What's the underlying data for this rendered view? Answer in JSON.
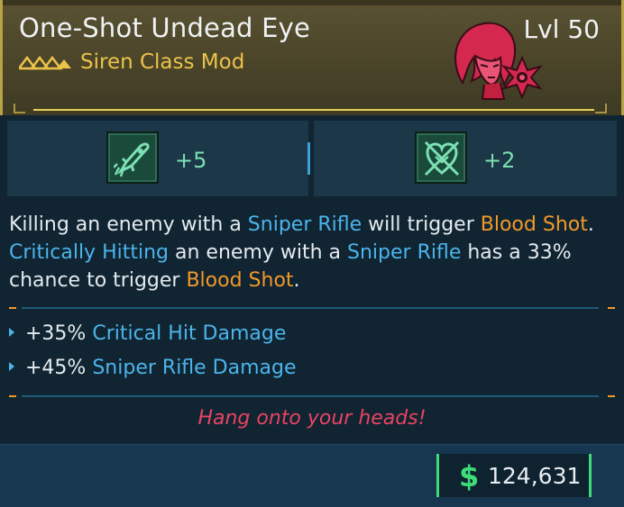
{
  "item": {
    "name": "One-Shot Undead Eye",
    "type": "Siren Class Mod",
    "level": "Lvl 50",
    "rarity_color": "#ecc34a",
    "class_color": "#d4284f"
  },
  "skills": [
    {
      "icon": "rocket-skill-icon",
      "value": "+5"
    },
    {
      "icon": "heart-crossed-skill-icon",
      "value": "+2"
    }
  ],
  "description": {
    "segments": [
      {
        "text": "Killing an enemy with a ",
        "style": "plain"
      },
      {
        "text": "Sniper Rifle",
        "style": "blue"
      },
      {
        "text": " will trigger ",
        "style": "plain"
      },
      {
        "text": "Blood Shot",
        "style": "orange"
      },
      {
        "text": ". ",
        "style": "plain"
      },
      {
        "text": "Critically Hitting",
        "style": "blue"
      },
      {
        "text": " an enemy with a ",
        "style": "plain"
      },
      {
        "text": "Sniper Rifle",
        "style": "blue"
      },
      {
        "text": " has a 33% chance to trigger ",
        "style": "plain"
      },
      {
        "text": "Blood Shot",
        "style": "orange"
      },
      {
        "text": ".",
        "style": "plain"
      }
    ]
  },
  "bonuses": [
    {
      "amount": "+35%",
      "stat": "Critical Hit Damage"
    },
    {
      "amount": "+45%",
      "stat": "Sniper Rifle Damage"
    }
  ],
  "flavor_text": "Hang onto your heads!",
  "price": {
    "currency_symbol": "$",
    "value": "124,631"
  }
}
